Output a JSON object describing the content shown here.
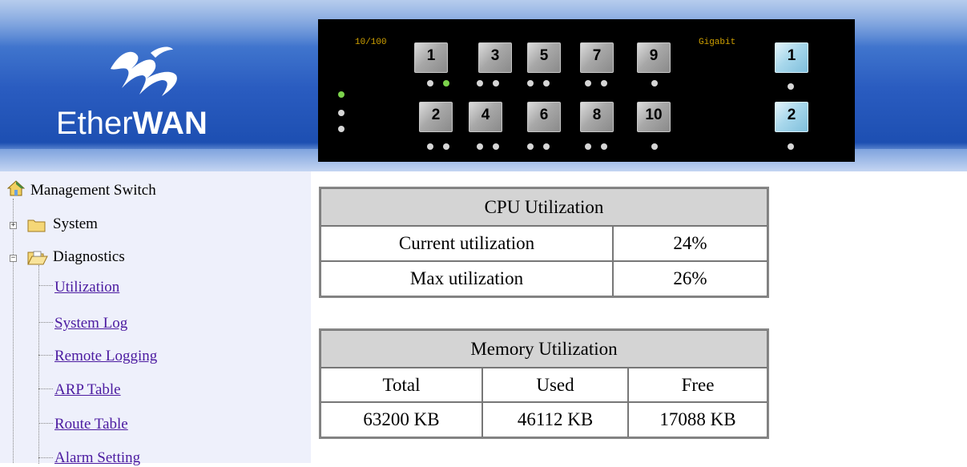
{
  "header": {
    "logo": {
      "text_light": "Ether",
      "text_bold": "WAN"
    },
    "switch_panel": {
      "label_fast": "10/100",
      "label_gigabit": "Gigabit",
      "fast_ports_top": [
        "1",
        "3",
        "5",
        "7",
        "9"
      ],
      "fast_ports_bottom": [
        "2",
        "4",
        "6",
        "8",
        "10"
      ],
      "gigabit_ports": [
        "1",
        "2"
      ],
      "active_led_color": "#7cd34c",
      "idle_led_color": "#d6d6d6"
    }
  },
  "sidebar": {
    "root": "Management Switch",
    "folders": [
      {
        "label": "System",
        "expanded": false
      },
      {
        "label": "Diagnostics",
        "expanded": true
      }
    ],
    "diagnostics_items": [
      "Utilization",
      "System Log",
      "Remote Logging",
      "ARP Table",
      "Route Table",
      "Alarm Setting"
    ]
  },
  "cpu": {
    "title": "CPU Utilization",
    "rows": [
      {
        "label": "Current utilization",
        "value": "24%"
      },
      {
        "label": "Max utilization",
        "value": "26%"
      }
    ]
  },
  "memory": {
    "title": "Memory Utilization",
    "headers": [
      "Total",
      "Used",
      "Free"
    ],
    "values": [
      "63200 KB",
      "46112 KB",
      "17088 KB"
    ]
  },
  "colors": {
    "banner_blue": "#2a5cc0",
    "link": "#4b1aa0",
    "sidebar_bg": "#eef0fb",
    "table_header_bg": "#d4d4d4"
  }
}
